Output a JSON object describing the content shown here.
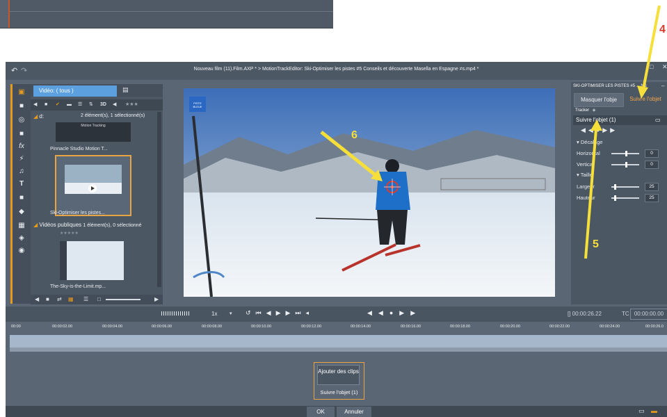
{
  "window": {
    "title": "Nouveau film (11).Film.AXP * >  MotionTrackEditor: Ski-Optimiser les pistes #5  Conseils et découverte Masella en Espagne ≠s.mp4 *"
  },
  "library": {
    "tab_label": "Vidéo: ( tous )",
    "group_folder": "d:",
    "group_count": "2 élément(s), 1 sélectionné(s)",
    "clips": [
      {
        "name": "Pinnacle Studio Motion T...",
        "thumb_caption": "Motion Tracking"
      },
      {
        "name": "Ski-Optimiser les pistes...",
        "selected": true
      }
    ],
    "public_section": "Vidéos publiques",
    "public_count": "1 élément(s), 0 sélectionné",
    "public_clips": [
      {
        "name": "The-Sky-is-the-Limit.mp..."
      }
    ]
  },
  "video": {
    "logo_text": "PISTE BLEUE"
  },
  "right_panel": {
    "header": "SKI-OPTIMISER LES PISTES #5 ... NS",
    "mask_button": "Masquer l'obje",
    "follow_button": "Suivre l'objet",
    "tracker_label": "Tracker",
    "object_header": "Suivre l'objet (1)",
    "offset_section": "Décalage",
    "horizontal_label": "Horizontal",
    "horizontal_value": "0",
    "vertical_label": "Vertical",
    "vertical_value": "0",
    "size_section": "Taille",
    "width_label": "Largeur",
    "width_value": "25",
    "height_label": "Hauteur",
    "height_value": "25"
  },
  "timeline": {
    "speed": "1x",
    "duration": "[] 00:00:26.22",
    "tc_label": "TC",
    "tc_value": "00:00:00.00",
    "ticks": [
      "00:00",
      "00:00:02.00",
      "00:00:04.00",
      "00:00:06.00",
      "00:00:08.00",
      "00:00:10.00",
      "00:00:12.00",
      "00:00:14.00",
      "00:00:16.00",
      "00:00:18.00",
      "00:00:20.00",
      "00:00:22.00",
      "00:00:24.00",
      "00:00:26.0"
    ]
  },
  "bottom": {
    "add_clips": "Ajouter des clips",
    "follow_label": "Suivre l'objet (1)",
    "ok": "OK",
    "cancel": "Annuler"
  },
  "annotations": [
    "4",
    "5",
    "6"
  ],
  "colors": {
    "accent_orange": "#e59a1c",
    "selection_blue": "#5da0e0",
    "annotation_yellow": "#f6df3a",
    "follow_orange": "#f2a54a"
  }
}
